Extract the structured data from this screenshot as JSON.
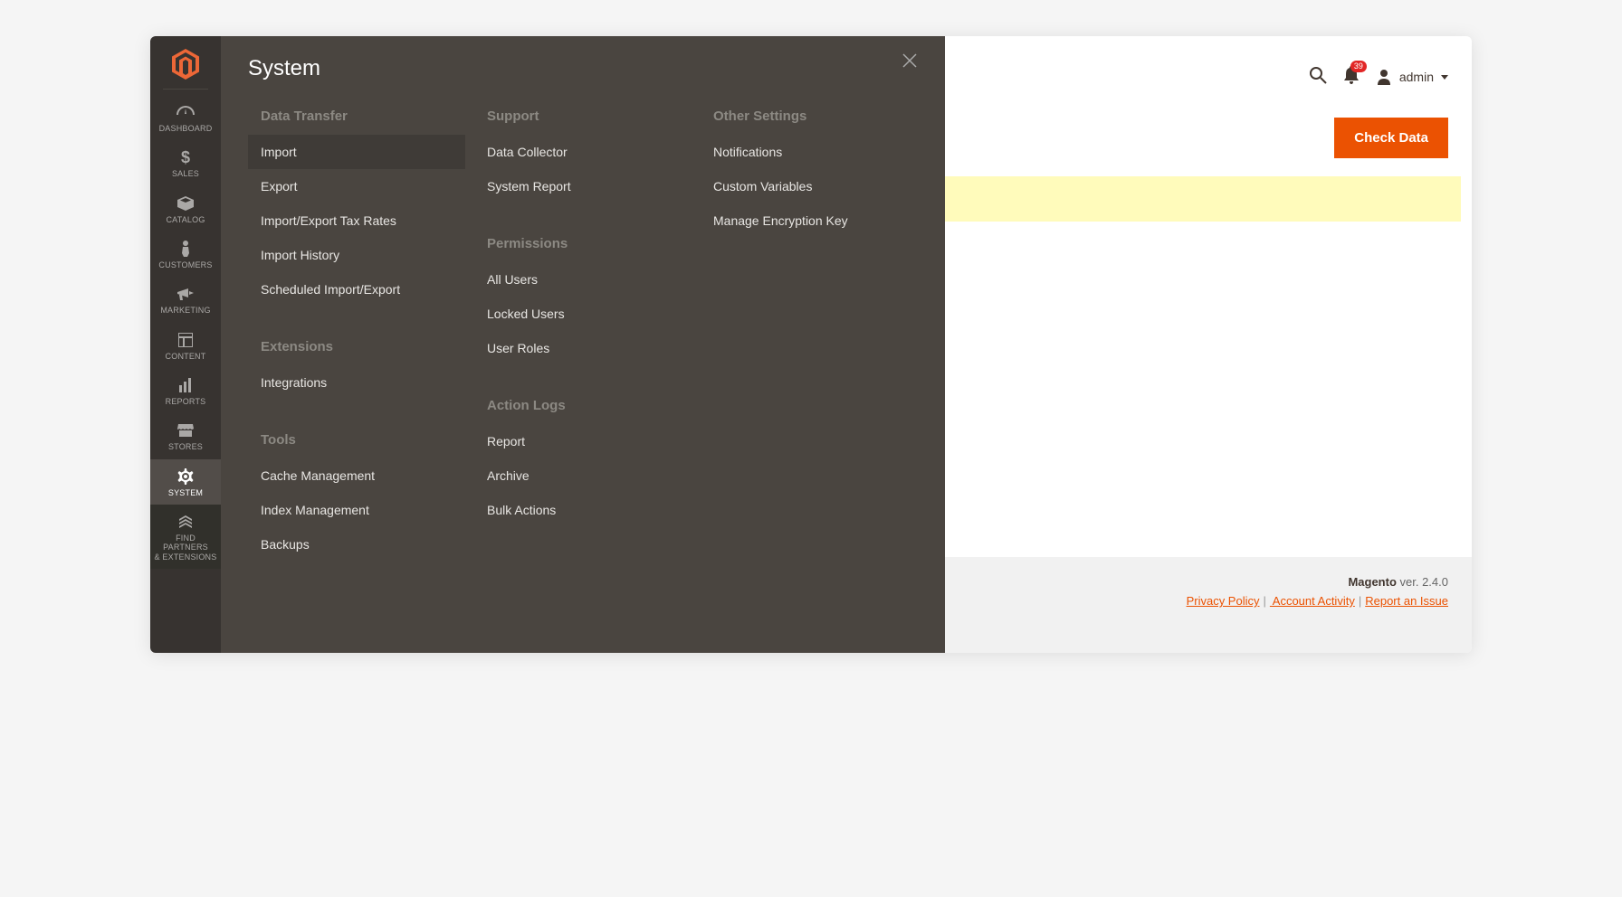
{
  "sidebar": {
    "items": [
      {
        "label": "DASHBOARD",
        "name": "dashboard"
      },
      {
        "label": "SALES",
        "name": "sales"
      },
      {
        "label": "CATALOG",
        "name": "catalog"
      },
      {
        "label": "CUSTOMERS",
        "name": "customers"
      },
      {
        "label": "MARKETING",
        "name": "marketing"
      },
      {
        "label": "CONTENT",
        "name": "content"
      },
      {
        "label": "REPORTS",
        "name": "reports"
      },
      {
        "label": "STORES",
        "name": "stores"
      },
      {
        "label": "SYSTEM",
        "name": "system"
      },
      {
        "label": "FIND PARTNERS\n& EXTENSIONS",
        "name": "find-partners"
      }
    ]
  },
  "flyout": {
    "title": "System",
    "col1": {
      "g1_title": "Data Transfer",
      "g1_items": [
        "Import",
        "Export",
        "Import/Export Tax Rates",
        "Import History",
        "Scheduled Import/Export"
      ],
      "g2_title": "Extensions",
      "g2_items": [
        "Integrations"
      ],
      "g3_title": "Tools",
      "g3_items": [
        "Cache Management",
        "Index Management",
        "Backups"
      ]
    },
    "col2": {
      "g1_title": "Support",
      "g1_items": [
        "Data Collector",
        "System Report"
      ],
      "g2_title": "Permissions",
      "g2_items": [
        "All Users",
        "Locked Users",
        "User Roles"
      ],
      "g3_title": "Action Logs",
      "g3_items": [
        "Report",
        "Archive",
        "Bulk Actions"
      ]
    },
    "col3": {
      "g1_title": "Other Settings",
      "g1_items": [
        "Notifications",
        "Custom Variables",
        "Manage Encryption Key"
      ]
    }
  },
  "header": {
    "notifications_count": "39",
    "admin_label": "admin",
    "check_data": "Check Data"
  },
  "footer": {
    "brand": "Magento",
    "ver_prefix": " ver. ",
    "version": "2.4.0",
    "privacy": "Privacy Policy",
    "activity": " Account Activity",
    "report": "Report an Issue"
  }
}
